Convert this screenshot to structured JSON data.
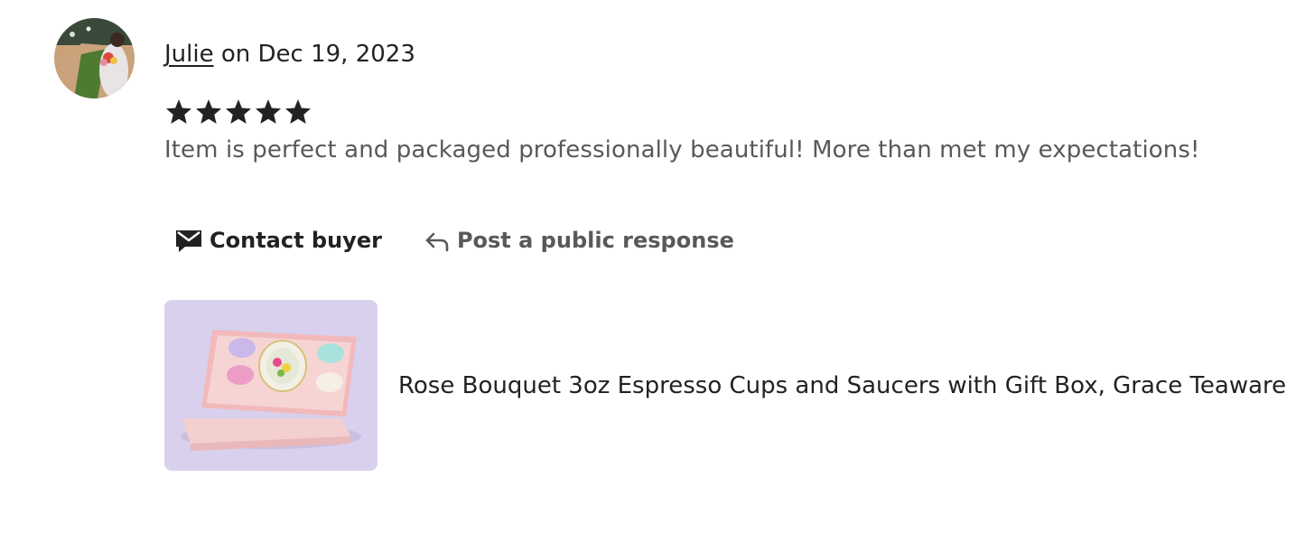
{
  "review": {
    "reviewer_name": "Julie",
    "date_text": " on Dec 19, 2023",
    "rating": 5,
    "rating_max": 5,
    "star_color": "#222222",
    "text": "Item is perfect and packaged professionally beautiful! More than met my expectations!"
  },
  "actions": {
    "contact_label": "Contact buyer",
    "contact_icon": "envelope-icon",
    "respond_label": "Post a public response",
    "respond_icon": "reply-arrow-icon"
  },
  "listing": {
    "title": "Rose Bouquet 3oz Espresso Cups and Saucers with Gift Box, Grace Teaware"
  }
}
